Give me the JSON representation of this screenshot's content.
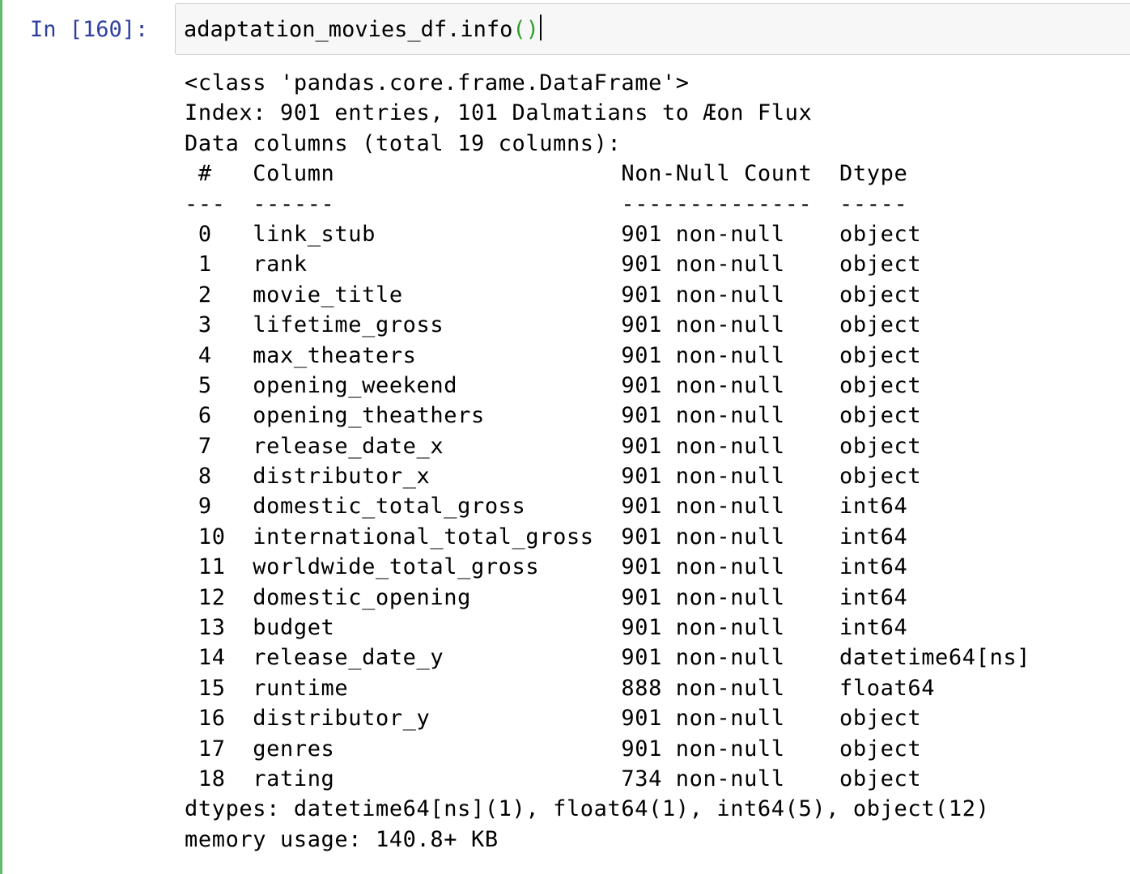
{
  "cell": {
    "prompt": "In [160]:",
    "code": {
      "object": "adaptation_movies_df",
      "method": ".info",
      "parens": "()"
    }
  },
  "output": {
    "header": [
      "<class 'pandas.core.frame.DataFrame'>",
      "Index: 901 entries, 101 Dalmatians to Æon Flux",
      "Data columns (total 19 columns):"
    ],
    "columns_header": " #   Column                     Non-Null Count  Dtype",
    "separator": "---  ------                     --------------  -----",
    "rows": [
      " 0   link_stub                  901 non-null    object",
      " 1   rank                       901 non-null    object",
      " 2   movie_title                901 non-null    object",
      " 3   lifetime_gross             901 non-null    object",
      " 4   max_theaters               901 non-null    object",
      " 5   opening_weekend            901 non-null    object",
      " 6   opening_theathers          901 non-null    object",
      " 7   release_date_x             901 non-null    object",
      " 8   distributor_x              901 non-null    object",
      " 9   domestic_total_gross       901 non-null    int64",
      " 10  international_total_gross  901 non-null    int64",
      " 11  worldwide_total_gross      901 non-null    int64",
      " 12  domestic_opening           901 non-null    int64",
      " 13  budget                     901 non-null    int64",
      " 14  release_date_y             901 non-null    datetime64[ns]",
      " 15  runtime                    888 non-null    float64",
      " 16  distributor_y              901 non-null    object",
      " 17  genres                     901 non-null    object",
      " 18  rating                     734 non-null    object"
    ],
    "footer": [
      "dtypes: datetime64[ns](1), float64(1), int64(5), object(12)",
      "memory usage: 140.8+ KB"
    ]
  }
}
